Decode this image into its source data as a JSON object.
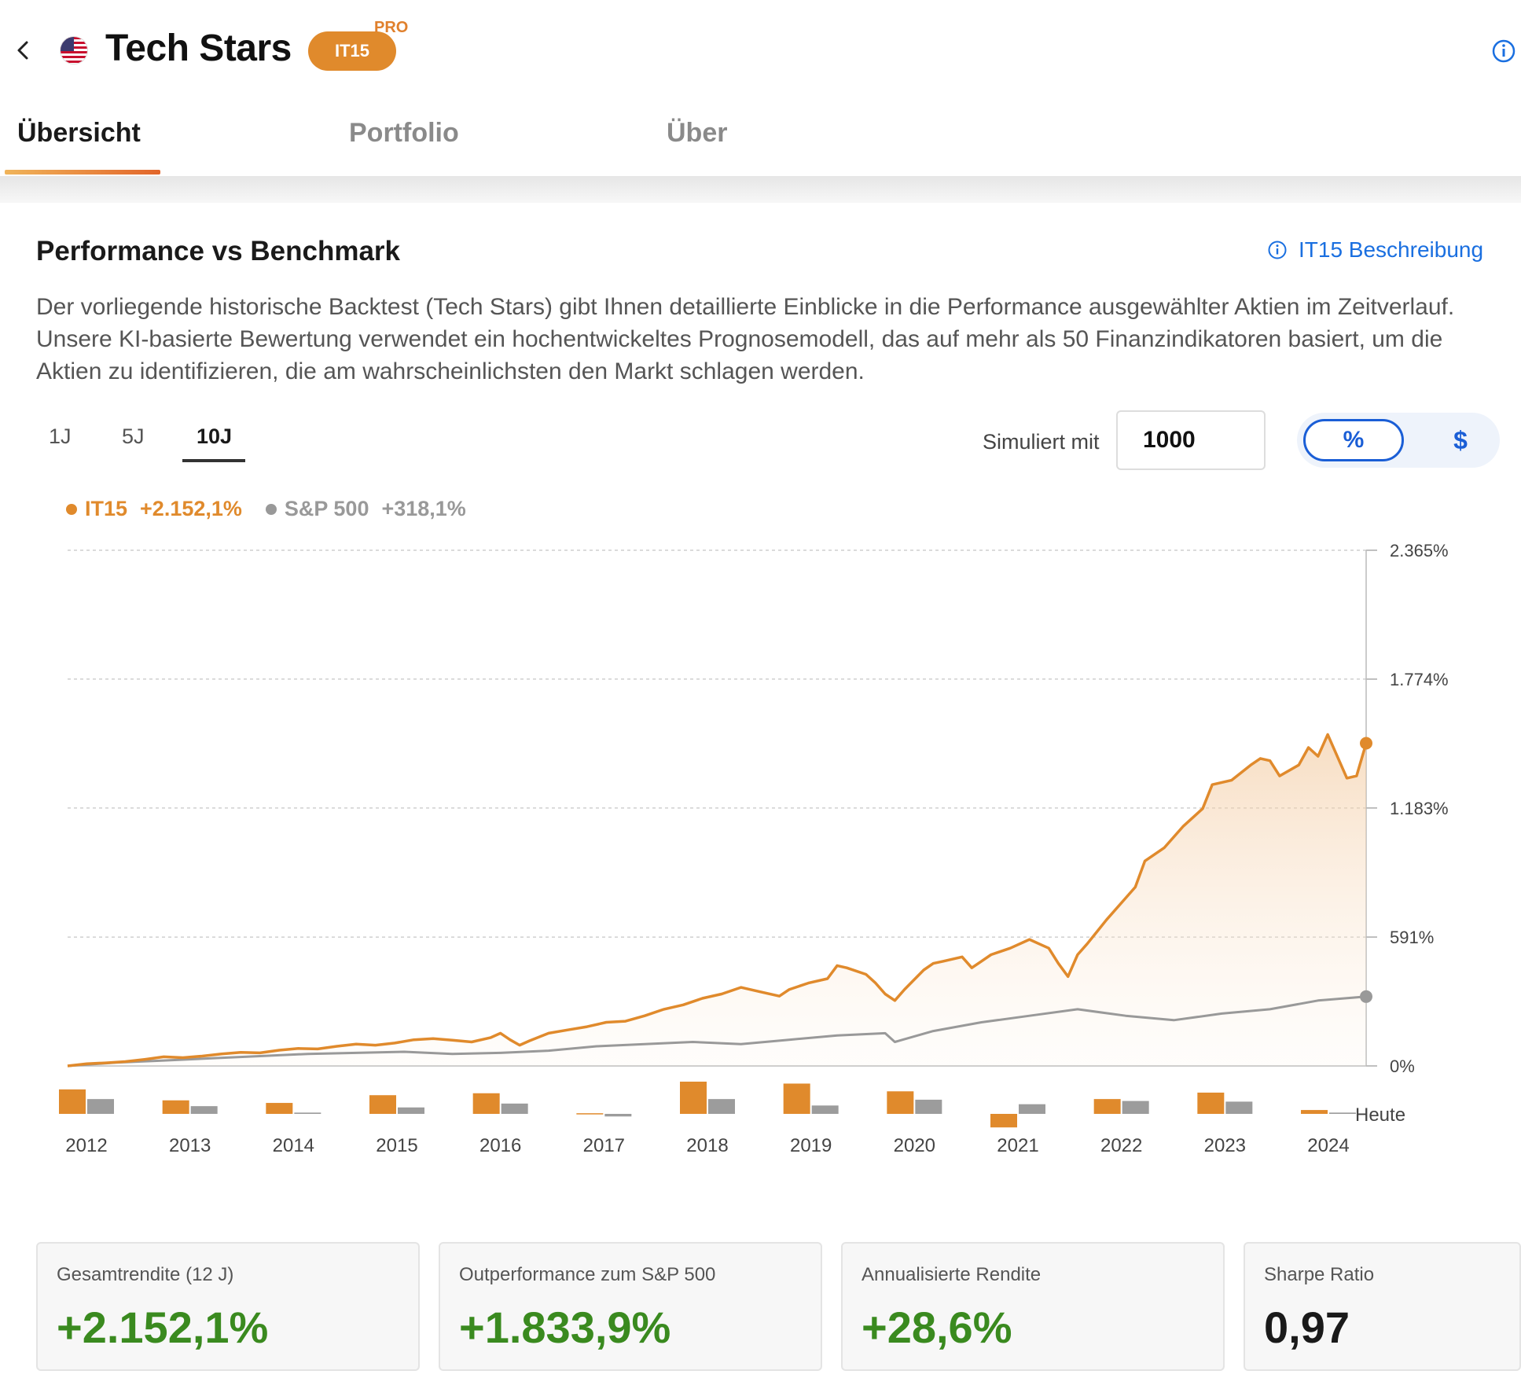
{
  "header": {
    "title": "Tech Stars",
    "ticker": "IT15",
    "badge": "PRO"
  },
  "tabs": [
    {
      "label": "Übersicht",
      "active": true
    },
    {
      "label": "Portfolio",
      "active": false
    },
    {
      "label": "Über",
      "active": false
    }
  ],
  "section": {
    "title": "Performance vs Benchmark",
    "link_label": "IT15 Beschreibung",
    "description": "Der vorliegende historische Backtest (Tech Stars) gibt Ihnen detaillierte Einblicke in die Performance ausgewählter Aktien im Zeitverlauf. Unsere KI-basierte Bewertung verwendet ein hochentwickeltes Prognosemodell, das auf mehr als 50 Finanzindikatoren basiert, um die Aktien zu identifizieren, die am wahrscheinlichsten den Markt schlagen werden."
  },
  "periods": [
    {
      "label": "1J",
      "active": false
    },
    {
      "label": "5J",
      "active": false
    },
    {
      "label": "10J",
      "active": true
    }
  ],
  "simulation": {
    "label": "Simuliert mit",
    "value": "1000",
    "toggle_pct": "%",
    "toggle_usd": "$",
    "selected": "%"
  },
  "legend": [
    {
      "name": "IT15",
      "value": "+2.152,1%",
      "color": "#e08a2c"
    },
    {
      "name": "S&P 500",
      "value": "+318,1%",
      "color": "#999999"
    }
  ],
  "colors": {
    "accent": "#e08a2c",
    "benchmark": "#999999",
    "link": "#1a6fe0",
    "positive": "#3a8a1f"
  },
  "chart_data": {
    "type": "line",
    "y_ticks": [
      "2.365%",
      "1.774%",
      "1.183%",
      "591%",
      "0%"
    ],
    "y_tick_values": [
      2365,
      1774,
      1183,
      591,
      0
    ],
    "ylim": [
      0,
      2365
    ],
    "xlim": [
      2011.5,
      2025.0
    ],
    "grid": true,
    "legend_position": "top-left",
    "series": [
      {
        "name": "IT15",
        "color": "#e08a2c",
        "points": [
          [
            2011.5,
            0
          ],
          [
            2011.7,
            10
          ],
          [
            2011.9,
            14
          ],
          [
            2012.1,
            20
          ],
          [
            2012.3,
            30
          ],
          [
            2012.5,
            42
          ],
          [
            2012.7,
            38
          ],
          [
            2012.9,
            45
          ],
          [
            2013.1,
            55
          ],
          [
            2013.3,
            62
          ],
          [
            2013.5,
            60
          ],
          [
            2013.7,
            72
          ],
          [
            2013.9,
            80
          ],
          [
            2014.1,
            78
          ],
          [
            2014.3,
            90
          ],
          [
            2014.5,
            100
          ],
          [
            2014.7,
            95
          ],
          [
            2014.9,
            105
          ],
          [
            2015.1,
            120
          ],
          [
            2015.3,
            125
          ],
          [
            2015.5,
            118
          ],
          [
            2015.7,
            110
          ],
          [
            2015.9,
            130
          ],
          [
            2016.0,
            150
          ],
          [
            2016.1,
            120
          ],
          [
            2016.2,
            95
          ],
          [
            2016.3,
            115
          ],
          [
            2016.5,
            150
          ],
          [
            2016.7,
            165
          ],
          [
            2016.9,
            180
          ],
          [
            2017.1,
            200
          ],
          [
            2017.3,
            205
          ],
          [
            2017.5,
            230
          ],
          [
            2017.7,
            260
          ],
          [
            2017.9,
            280
          ],
          [
            2018.1,
            310
          ],
          [
            2018.3,
            330
          ],
          [
            2018.5,
            360
          ],
          [
            2018.7,
            340
          ],
          [
            2018.9,
            320
          ],
          [
            2019.0,
            350
          ],
          [
            2019.2,
            380
          ],
          [
            2019.4,
            400
          ],
          [
            2019.5,
            460
          ],
          [
            2019.6,
            450
          ],
          [
            2019.8,
            420
          ],
          [
            2019.9,
            380
          ],
          [
            2020.0,
            330
          ],
          [
            2020.1,
            300
          ],
          [
            2020.2,
            350
          ],
          [
            2020.4,
            440
          ],
          [
            2020.5,
            470
          ],
          [
            2020.6,
            480
          ],
          [
            2020.8,
            500
          ],
          [
            2020.9,
            450
          ],
          [
            2021.0,
            480
          ],
          [
            2021.1,
            510
          ],
          [
            2021.3,
            540
          ],
          [
            2021.5,
            580
          ],
          [
            2021.6,
            560
          ],
          [
            2021.7,
            540
          ],
          [
            2021.8,
            470
          ],
          [
            2021.9,
            410
          ],
          [
            2022.0,
            510
          ],
          [
            2022.1,
            560
          ],
          [
            2022.3,
            670
          ],
          [
            2022.5,
            770
          ],
          [
            2022.6,
            820
          ],
          [
            2022.7,
            940
          ],
          [
            2022.9,
            1000
          ],
          [
            2023.1,
            1100
          ],
          [
            2023.3,
            1180
          ],
          [
            2023.4,
            1290
          ],
          [
            2023.6,
            1310
          ],
          [
            2023.8,
            1380
          ],
          [
            2023.9,
            1410
          ],
          [
            2024.0,
            1400
          ],
          [
            2024.1,
            1330
          ],
          [
            2024.3,
            1380
          ],
          [
            2024.4,
            1460
          ],
          [
            2024.5,
            1420
          ],
          [
            2024.6,
            1520
          ],
          [
            2024.8,
            1320
          ],
          [
            2024.9,
            1330
          ],
          [
            2025.0,
            1480
          ]
        ]
      },
      {
        "name": "S&P 500",
        "color": "#999999",
        "points": [
          [
            2011.5,
            0
          ],
          [
            2012.0,
            15
          ],
          [
            2012.5,
            25
          ],
          [
            2013.0,
            35
          ],
          [
            2013.5,
            45
          ],
          [
            2014.0,
            55
          ],
          [
            2014.5,
            60
          ],
          [
            2015.0,
            65
          ],
          [
            2015.5,
            55
          ],
          [
            2016.0,
            60
          ],
          [
            2016.5,
            70
          ],
          [
            2017.0,
            90
          ],
          [
            2017.5,
            100
          ],
          [
            2018.0,
            110
          ],
          [
            2018.5,
            100
          ],
          [
            2019.0,
            120
          ],
          [
            2019.5,
            140
          ],
          [
            2020.0,
            150
          ],
          [
            2020.1,
            110
          ],
          [
            2020.5,
            160
          ],
          [
            2021.0,
            200
          ],
          [
            2021.5,
            230
          ],
          [
            2022.0,
            260
          ],
          [
            2022.5,
            230
          ],
          [
            2023.0,
            210
          ],
          [
            2023.5,
            240
          ],
          [
            2024.0,
            260
          ],
          [
            2024.5,
            300
          ],
          [
            2025.0,
            318
          ]
        ]
      }
    ],
    "x_tick_labels": [
      "2012",
      "2013",
      "2014",
      "2015",
      "2016",
      "2017",
      "2018",
      "2019",
      "2020",
      "2021",
      "2022",
      "2023",
      "2024"
    ],
    "today_label": "Heute",
    "annual_returns": {
      "years": [
        2012,
        2013,
        2014,
        2015,
        2016,
        2017,
        2018,
        2019,
        2020,
        2021,
        2022,
        2023,
        2024
      ],
      "it15": [
        38,
        21,
        17,
        29,
        32,
        1,
        50,
        47,
        35,
        -21,
        23,
        33,
        6
      ],
      "sp500": [
        23,
        12,
        2,
        10,
        16,
        -4,
        23,
        13,
        22,
        15,
        20,
        19,
        2
      ]
    }
  },
  "stats": [
    {
      "label": "Gesamtrendite (12 J)",
      "value": "+2.152,1%"
    },
    {
      "label": "Outperformance zum S&P 500",
      "value": "+1.833,9%"
    },
    {
      "label": "Annualisierte Rendite",
      "value": "+28,6%"
    },
    {
      "label": "Sharpe Ratio",
      "value": "0,97"
    }
  ]
}
